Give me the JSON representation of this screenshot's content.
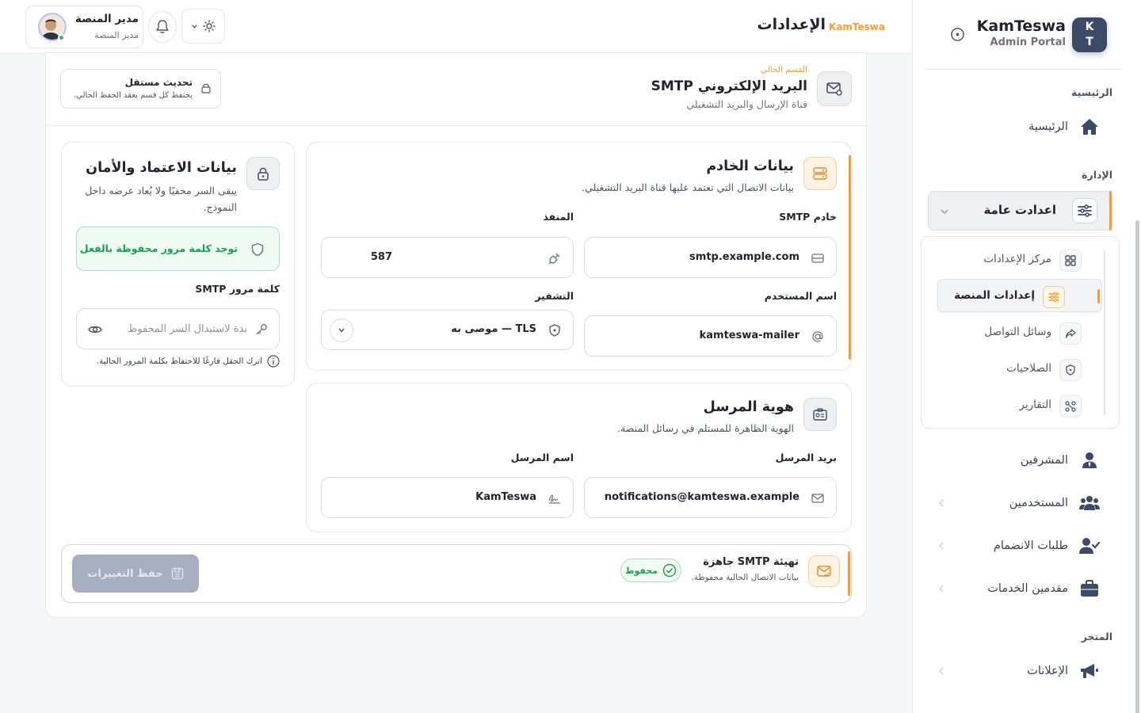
{
  "brand": {
    "logo_initials_top": "K",
    "logo_initials_bottom": "T",
    "name": "KamTeswa",
    "subtitle": "Admin Portal"
  },
  "sidebar": {
    "sections": {
      "home": "الرئيسية",
      "admin": "الإدارة",
      "store": "المتجر"
    },
    "home_item": "الرئيسية",
    "active_group": "اعدادت عامة",
    "submenu": [
      {
        "label": "مركز الإعدادات",
        "icon": "grid-icon"
      },
      {
        "label": "إعدادات المنصة",
        "icon": "sliders-icon",
        "active": true
      },
      {
        "label": "وسائل التواصل",
        "icon": "share-icon"
      },
      {
        "label": "الصلاحيات",
        "icon": "shield-icon"
      },
      {
        "label": "التقارير",
        "icon": "chart-nodes-icon"
      }
    ],
    "items": [
      {
        "label": "المشرفين",
        "icon": "user-tie-icon"
      },
      {
        "label": "المستخدمين",
        "icon": "users-icon"
      },
      {
        "label": "طلبات الانضمام",
        "icon": "user-check-icon"
      },
      {
        "label": "مقدمين الخدمات",
        "icon": "briefcase-icon"
      }
    ],
    "store_items": [
      {
        "label": "الإعلانات",
        "icon": "megaphone-icon"
      }
    ]
  },
  "topbar": {
    "title": "الإعدادات",
    "brand_tag": "KamTeswa",
    "user_name": "مدير المنصة",
    "user_role": "مدير المنصة"
  },
  "section_header": {
    "current_label": "القسم الحالي",
    "title": "البريد الإلكتروني SMTP",
    "subtitle": "قناة الإرسال والبريد التشغيلي",
    "independent_title": "تحديث مستقل",
    "independent_sub": "يحتفظ كل قسم بعقد الحفظ الحالي."
  },
  "server_panel": {
    "title": "بيانات الخادم",
    "subtitle": "بيانات الاتصال التي تعتمد عليها قناة البريد التشغيلي.",
    "host_label": "خادم SMTP",
    "host_value": "smtp.example.com",
    "port_label": "المنفذ",
    "port_value": "587",
    "username_label": "اسم المستخدم",
    "username_value": "kamteswa-mailer",
    "encryption_label": "التشفير",
    "encryption_value": "TLS — موصى به"
  },
  "sender_panel": {
    "title": "هوية المرسل",
    "subtitle": "الهوية الظاهرة للمستلم في رسائل المنصة.",
    "email_label": "بريد المرسل",
    "email_value": "notifications@kamteswa.example",
    "name_label": "اسم المرسل",
    "name_value": "KamTeswa"
  },
  "credentials_panel": {
    "title": "بيانات الاعتماد والأمان",
    "subtitle_line1": "يبقى السر مخفيًا ولا يُعاد عرضه داخل",
    "subtitle_line2": "النموذج.",
    "saved_note": "توجد كلمة مرور محفوظة بالفعل",
    "password_label": "كلمة مرور SMTP",
    "password_placeholder": "بدة لاستبدال السر المحفوظ",
    "hint": "اترك الحقل فارغًا للاحتفاظ بكلمة المرور الحالية."
  },
  "footer": {
    "title": "تهيئة SMTP جاهزة",
    "subtitle": "بيانات الاتصال الحالية محفوظة.",
    "badge": "محفوظ",
    "save_button": "حفظ التغييرات"
  },
  "colors": {
    "accent": "#f59e2b",
    "primary": "#3b4a66",
    "success": "#15a34a"
  }
}
